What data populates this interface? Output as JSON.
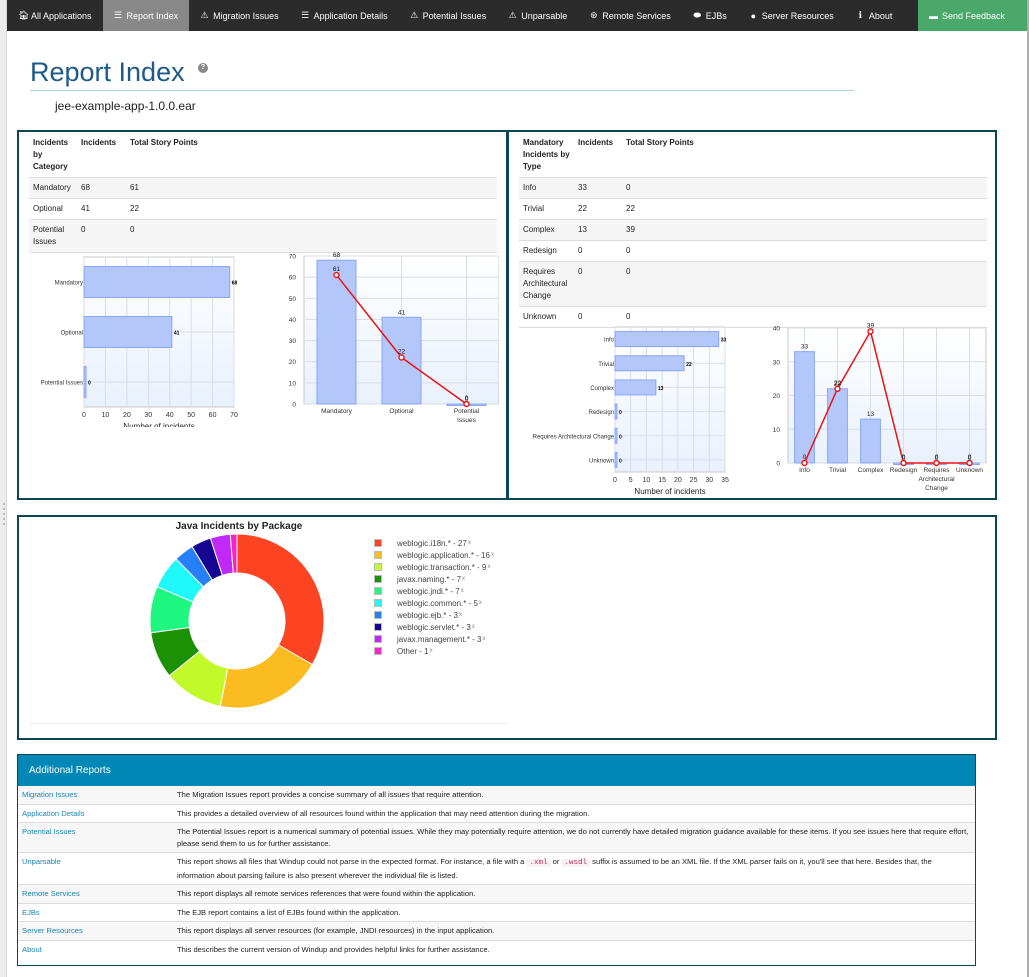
{
  "nav": {
    "items": [
      {
        "label": "All Applications",
        "icon": "home-icon",
        "glyph": "🏠︎",
        "active": false
      },
      {
        "label": "Report Index",
        "icon": "list-icon",
        "glyph": "☰",
        "active": true
      },
      {
        "label": "Migration Issues",
        "icon": "warning-icon",
        "glyph": "⚠",
        "active": false
      },
      {
        "label": "Application Details",
        "icon": "list-icon",
        "glyph": "☰",
        "active": false
      },
      {
        "label": "Potential Issues",
        "icon": "warning-icon",
        "glyph": "⚠",
        "active": false
      },
      {
        "label": "Unparsable",
        "icon": "warning-icon",
        "glyph": "⚠",
        "active": false
      },
      {
        "label": "Remote Services",
        "icon": "transfer-icon",
        "glyph": "⊛",
        "active": false
      },
      {
        "label": "EJBs",
        "icon": "bean-icon",
        "glyph": "⬬",
        "active": false
      },
      {
        "label": "Server Resources",
        "icon": "globe-icon",
        "glyph": "●",
        "active": false
      },
      {
        "label": "About",
        "icon": "info-icon",
        "glyph": "ℹ",
        "active": false
      }
    ],
    "feedback": {
      "label": "Send Feedback",
      "icon": "comment-icon",
      "glyph": "▬"
    }
  },
  "header": {
    "title": "Report Index",
    "help_glyph": "?",
    "app_name": "jee-example-app-1.0.0.ear"
  },
  "category_table": {
    "headers": [
      "Incidents by Category",
      "Incidents",
      "Total Story Points"
    ],
    "rows": [
      [
        "Mandatory",
        "68",
        "61"
      ],
      [
        "Optional",
        "41",
        "22"
      ],
      [
        "Potential Issues",
        "0",
        "0"
      ]
    ]
  },
  "type_table": {
    "headers": [
      "Mandatory Incidents by Type",
      "Incidents",
      "Total Story Points"
    ],
    "rows": [
      [
        "Info",
        "33",
        "0"
      ],
      [
        "Trivial",
        "22",
        "22"
      ],
      [
        "Complex",
        "13",
        "39"
      ],
      [
        "Redesign",
        "0",
        "0"
      ],
      [
        "Requires Architectural Change",
        "0",
        "0"
      ],
      [
        "Unknown",
        "0",
        "0"
      ]
    ]
  },
  "package_legend": [
    {
      "label": "weblogic.i18n.* - 27",
      "count_suffix": "x",
      "color": "#fc4422"
    },
    {
      "label": "weblogic.application.* - 16",
      "count_suffix": "x",
      "color": "#fbbc22"
    },
    {
      "label": "weblogic.transaction.* - 9",
      "count_suffix": "x",
      "color": "#c1f92a"
    },
    {
      "label": "javax.naming.* - 7",
      "count_suffix": "x",
      "color": "#1d9106"
    },
    {
      "label": "weblogic.jndi.* - 7",
      "count_suffix": "x",
      "color": "#1ff880"
    },
    {
      "label": "weblogic.common.* - 5",
      "count_suffix": "x",
      "color": "#1ff9f9"
    },
    {
      "label": "weblogic.ejb.* - 3",
      "count_suffix": "x",
      "color": "#2780f9"
    },
    {
      "label": "weblogic.servlet.* - 3",
      "count_suffix": "x",
      "color": "#160592"
    },
    {
      "label": "javax.management.* - 3",
      "count_suffix": "x",
      "color": "#c129f9"
    },
    {
      "label": "Other - 1",
      "count_suffix": "x",
      "color": "#f626c6"
    }
  ],
  "additional_reports": {
    "title": "Additional Reports",
    "rows": [
      {
        "name": "Migration Issues",
        "desc": "The Migration Issues report provides a concise summary of all issues that require attention."
      },
      {
        "name": "Application Details",
        "desc": "This provides a detailed overview of all resources found within the application that may need attention during the migration."
      },
      {
        "name": "Potential Issues",
        "desc": "The Potential Issues report is a numerical summary of potential issues. While they may potentially require attention, we do not currently have detailed migration guidance available for these items. If you see issues here that require effort, please send them to us for further assistance."
      },
      {
        "name": "Unparsable",
        "desc_pre": "This report shows all files that Windup could not parse in the expected format. For instance, a file with a",
        "code1": ".xml",
        "desc_mid": "or",
        "code2": ".wsdl",
        "desc_post": "suffix is assumed to be an XML file. If the XML parser fails on it, you'll see that here. Besides that, the information about parsing failure is also present wherever the individual file is listed."
      },
      {
        "name": "Remote Services",
        "desc": "This report displays all remote services references that were found within the application."
      },
      {
        "name": "EJBs",
        "desc": "The EJB report contains a list of EJBs found within the application."
      },
      {
        "name": "Server Resources",
        "desc": "This report displays all server resources (for example, JNDI resources) in the input application."
      },
      {
        "name": "About",
        "desc": "This describes the current version of Windup and provides helpful links for further assistance."
      }
    ]
  },
  "chart_data": [
    {
      "id": "cat-hbar",
      "type": "bar",
      "orientation": "horizontal",
      "categories": [
        "Mandatory",
        "Optional",
        "Potential Issues"
      ],
      "values": [
        68,
        41,
        0
      ],
      "xlabel": "Number of incidents",
      "xlim": [
        0,
        70
      ],
      "xticks": [
        0,
        10,
        20,
        30,
        40,
        50,
        60,
        70
      ],
      "grid": true
    },
    {
      "id": "cat-combo",
      "type": "bar",
      "categories": [
        "Mandatory",
        "Optional",
        "Potential Issues"
      ],
      "series": [
        {
          "name": "Incidents",
          "kind": "bar",
          "values": [
            68,
            41,
            0
          ]
        },
        {
          "name": "Total Story Points",
          "kind": "line",
          "values": [
            61,
            22,
            0
          ]
        }
      ],
      "ylim": [
        0,
        70
      ],
      "yticks": [
        0,
        10,
        20,
        30,
        40,
        50,
        60,
        70
      ],
      "grid": true
    },
    {
      "id": "type-hbar",
      "type": "bar",
      "orientation": "horizontal",
      "categories": [
        "Info",
        "Trivial",
        "Complex",
        "Redesign",
        "Requires Architectural Change",
        "Unknown"
      ],
      "values": [
        33,
        22,
        13,
        0,
        0,
        0
      ],
      "xlabel": "Number of incidents",
      "xlim": [
        0,
        35
      ],
      "xticks": [
        0,
        5,
        10,
        15,
        20,
        25,
        30,
        35
      ],
      "grid": true
    },
    {
      "id": "type-combo",
      "type": "bar",
      "categories": [
        "Info",
        "Trivial",
        "Complex",
        "Redesign",
        "Requires Architectural Change",
        "Unknown"
      ],
      "series": [
        {
          "name": "Incidents",
          "kind": "bar",
          "values": [
            33,
            22,
            13,
            0,
            0,
            0
          ]
        },
        {
          "name": "Total Story Points",
          "kind": "line",
          "values": [
            0,
            22,
            39,
            0,
            0,
            0
          ]
        }
      ],
      "ylim": [
        0,
        40
      ],
      "yticks": [
        0,
        10,
        20,
        30,
        40
      ],
      "grid": true
    },
    {
      "id": "pkg-donut",
      "type": "pie",
      "title": "Java Incidents by Package",
      "donut": true,
      "categories": [
        "weblogic.i18n.*",
        "weblogic.application.*",
        "weblogic.transaction.*",
        "javax.naming.*",
        "weblogic.jndi.*",
        "weblogic.common.*",
        "weblogic.ejb.*",
        "weblogic.servlet.*",
        "javax.management.*",
        "Other"
      ],
      "values": [
        27,
        16,
        9,
        7,
        7,
        5,
        3,
        3,
        3,
        1
      ],
      "colors": [
        "#fc4422",
        "#fbbc22",
        "#c1f92a",
        "#1d9106",
        "#1ff880",
        "#1ff9f9",
        "#2780f9",
        "#160592",
        "#c129f9",
        "#f626c6"
      ],
      "legend": "right"
    }
  ]
}
